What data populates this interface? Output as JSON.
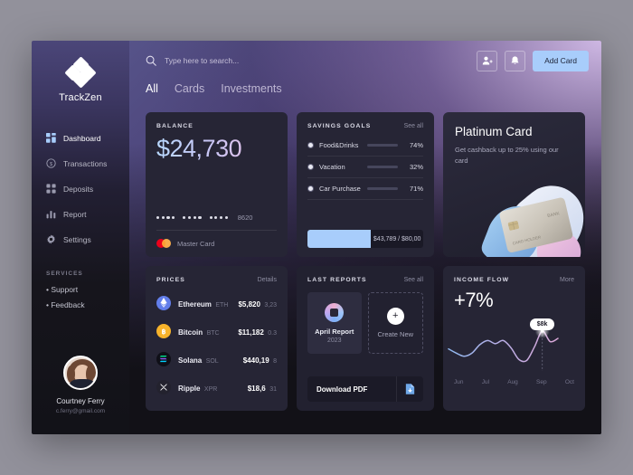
{
  "brand": {
    "name": "TrackZen",
    "logo_icon": "diamond-logo-icon"
  },
  "sidebar": {
    "nav": [
      {
        "label": "Dashboard",
        "icon": "grid-icon",
        "active": true
      },
      {
        "label": "Transactions",
        "icon": "dollar-circle-icon",
        "active": false
      },
      {
        "label": "Deposits",
        "icon": "deposits-icon",
        "active": false
      },
      {
        "label": "Report",
        "icon": "bar-chart-icon",
        "active": false
      },
      {
        "label": "Settings",
        "icon": "gear-icon",
        "active": false
      }
    ],
    "services_title": "SERVICES",
    "services": [
      {
        "label": "Support"
      },
      {
        "label": "Feedback"
      }
    ],
    "profile": {
      "name": "Courtney Ferry",
      "email": "c.ferry@gmail.com",
      "avatar_icon": "user-avatar"
    }
  },
  "header": {
    "search": {
      "placeholder": "Type here to search...",
      "value": "",
      "icon": "search-icon"
    },
    "add_contact_icon": "add-user-icon",
    "notifications_icon": "bell-icon",
    "add_card_label": "Add Card"
  },
  "tabs": [
    {
      "label": "All",
      "active": true
    },
    {
      "label": "Cards",
      "active": false
    },
    {
      "label": "Investments",
      "active": false
    }
  ],
  "balance": {
    "title": "BALANCE",
    "amount": "$24,730",
    "masked_digits": "•••• •••• ••••",
    "last4": "8620",
    "brand_label": "Master Card",
    "brand_icon": "mastercard-icon"
  },
  "savings": {
    "title": "SAVINGS GOALS",
    "link": "See all",
    "goals": [
      {
        "label": "Food&Drinks",
        "percent": "74%",
        "value": 74,
        "color": "#f0a7dd"
      },
      {
        "label": "Vacation",
        "percent": "32%",
        "value": 32,
        "color": "#79b6f5"
      },
      {
        "label": "Car Purchase",
        "percent": "71%",
        "value": 71,
        "color": "#f2f2f8"
      }
    ],
    "total": {
      "saved": "$43,789",
      "target": "$80,00",
      "display": "$43,789 / $80,00",
      "percent": 55
    }
  },
  "platinum": {
    "title": "Platinum Card",
    "subtitle": "Get cashback up to 25% using our card",
    "art_icon": "platinum-card-art"
  },
  "prices": {
    "title": "PRICES",
    "link": "Details",
    "coins": [
      {
        "name": "Ethereum",
        "symbol": "ETH",
        "price": "$5,820",
        "change": "3,23",
        "icon": "ethereum-icon",
        "color": "#627eea"
      },
      {
        "name": "Bitcoin",
        "symbol": "BTC",
        "price": "$11,182",
        "change": "0.3",
        "icon": "bitcoin-icon",
        "color": "#f7b32b"
      },
      {
        "name": "Solana",
        "symbol": "SOL",
        "price": "$440,19",
        "change": "8",
        "icon": "solana-icon",
        "color": "#0f0f17"
      },
      {
        "name": "Ripple",
        "symbol": "XPR",
        "price": "$18,6",
        "change": "31",
        "icon": "ripple-icon",
        "color": "#23222e"
      }
    ]
  },
  "reports": {
    "title": "LAST REPORTS",
    "link": "See all",
    "items": [
      {
        "name": "April Report",
        "year": "2023",
        "icon": "report-gradient-icon"
      }
    ],
    "create_new_label": "Create New",
    "create_new_icon": "plus-icon",
    "download_label": "Download PDF",
    "download_icon": "pdf-download-icon"
  },
  "income": {
    "title": "INCOME FLOW",
    "link": "More",
    "percent": "+7%",
    "tooltip": "$8k"
  },
  "chart_data": {
    "type": "line",
    "title": "INCOME FLOW",
    "xlabel": "",
    "ylabel": "",
    "grid": false,
    "legend": false,
    "categories": [
      "Jun",
      "Jul",
      "Aug",
      "Sep",
      "Oct"
    ],
    "tick_labels": [
      "Jun",
      "Jul",
      "Aug",
      "Sep",
      "Oct"
    ],
    "annotation": {
      "label": "$8k",
      "at": "Sep"
    },
    "series": [
      {
        "name": "Income",
        "x": [
          0,
          8,
          16,
          24,
          32,
          40,
          48,
          56,
          64,
          72,
          80,
          88,
          96,
          104,
          112
        ],
        "values": [
          42,
          34,
          28,
          34,
          50,
          58,
          52,
          58,
          44,
          22,
          20,
          46,
          76,
          56,
          62
        ]
      }
    ],
    "ylim": [
      0,
      100
    ],
    "colors": {
      "start": "#8fb8ef",
      "end": "#d9a6d6"
    }
  },
  "theme": {
    "accent": "#a8cdfb",
    "card_bg": "#262535",
    "app_bg": "#121117",
    "page_bg": "#92919b"
  }
}
